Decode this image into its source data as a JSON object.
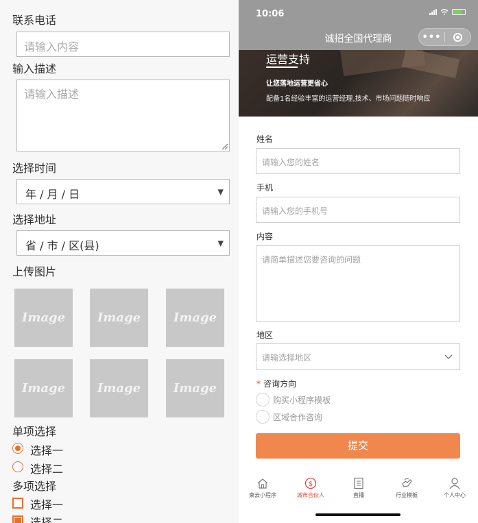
{
  "left_form": {
    "phone_label": "联系电话",
    "phone_placeholder": "请输入内容",
    "desc_label": "输入描述",
    "desc_placeholder": "请输入描述",
    "time_label": "选择时间",
    "time_value": "年 / 月 / 日",
    "address_label": "选择地址",
    "address_value": "省 / 市 / 区(县)",
    "upload_label": "上传图片",
    "image_placeholder_text": "Image",
    "single_label": "单项选择",
    "single_options": [
      "选择一",
      "选择二"
    ],
    "multi_label": "多项选择",
    "multi_options": [
      "选择一",
      "选择二"
    ]
  },
  "phone": {
    "time": "10:06",
    "nav_title": "诚招全国代理商",
    "capsule_more": "•••",
    "banner": {
      "heading": "运营支持",
      "subtitle": "让您落地运营更省心",
      "description": "配备1名经验丰富的运营经理,技术、市场问题随时响应"
    },
    "form": {
      "name_label": "姓名",
      "name_placeholder": "请输入您的姓名",
      "mobile_label": "手机",
      "mobile_placeholder": "请输入您的手机号",
      "content_label": "内容",
      "content_placeholder": "请简单描述您要咨询的问题",
      "region_label": "地区",
      "region_placeholder": "请输选择地区",
      "direction_required_mark": "*",
      "direction_label": "咨询方向",
      "direction_options": [
        "购买小程序模板",
        "区域合作咨询"
      ],
      "submit_label": "提交"
    },
    "tabbar": [
      {
        "label": "柬云小程序",
        "icon": "home-icon",
        "active": false
      },
      {
        "label": "城市合伙人",
        "icon": "dollar-circle-icon",
        "active": true
      },
      {
        "label": "直播",
        "icon": "document-icon",
        "active": false
      },
      {
        "label": "行业模板",
        "icon": "hand-icon",
        "active": false
      },
      {
        "label": "个人中心",
        "icon": "user-icon",
        "active": false
      }
    ],
    "colors": {
      "accent": "#f0884d",
      "radio_orange": "#e8702a",
      "active_tab": "#e64340",
      "nav_bg": "#9a9a9a"
    }
  }
}
